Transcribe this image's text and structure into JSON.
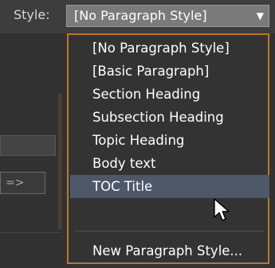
{
  "style_field": {
    "label": "Style:",
    "value": "[No Paragraph Style]",
    "arrow_glyph": "▼"
  },
  "background": {
    "button_label": "=>"
  },
  "dropdown": {
    "items": [
      {
        "label": "[No Paragraph Style]"
      },
      {
        "label": "[Basic Paragraph]"
      },
      {
        "label": "Section Heading"
      },
      {
        "label": "Subsection Heading"
      },
      {
        "label": "Topic Heading"
      },
      {
        "label": "Body text"
      },
      {
        "label": "TOC Title",
        "selected": true
      },
      {
        "label": "New Paragraph Style..."
      }
    ]
  },
  "colors": {
    "menu_border": "#b67a28",
    "selection": "#4e5868",
    "menu_background": "#333333"
  },
  "icons": {
    "cursor": "arrow-cursor-icon",
    "dropdown": "dropdown-arrow-icon"
  }
}
